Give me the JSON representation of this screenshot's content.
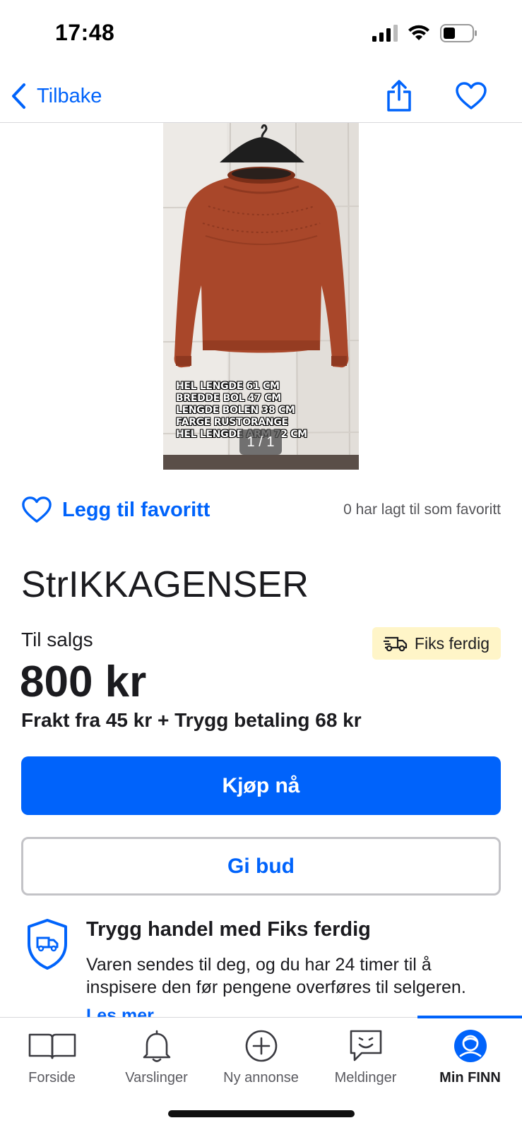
{
  "status_bar": {
    "time": "17:48"
  },
  "nav": {
    "back_label": "Tilbake",
    "icons": [
      "chevron-left-icon",
      "share-icon",
      "heart-outline-icon"
    ]
  },
  "gallery": {
    "counter": "1 / 1",
    "image_description_colors": {
      "sweater": "#a9472a",
      "wall": "#e9e6e2"
    },
    "overlay_lines": [
      "HEL LENGDE 61 CM",
      "BREDDE BOL 47 CM",
      "LENGDE BOLEN 38 CM",
      "FARGE RUSTORANGE",
      "HEL LENGDE ARM 72 CM"
    ]
  },
  "favorite": {
    "add_label": "Legg til favoritt",
    "count_text": "0 har lagt til som favoritt"
  },
  "listing": {
    "title": "StrIKKAGENSER",
    "sale_label": "Til salgs",
    "badge_label": "Fiks ferdig",
    "price": "800 kr",
    "shipping": "Frakt fra 45 kr + Trygg betaling 68 kr"
  },
  "actions": {
    "buy_label": "Kjøp nå",
    "bid_label": "Gi bud"
  },
  "safe_trade": {
    "title": "Trygg handel med Fiks ferdig",
    "text": "Varen sendes til deg, og du har 24 timer til å inspisere den før pengene overføres til selgeren.",
    "read_more": "Les mer"
  },
  "tab_bar": {
    "tabs": [
      {
        "label": "Forside",
        "icon": "book-icon"
      },
      {
        "label": "Varslinger",
        "icon": "bell-icon"
      },
      {
        "label": "Ny annonse",
        "icon": "plus-circle-icon"
      },
      {
        "label": "Meldinger",
        "icon": "message-icon"
      },
      {
        "label": "Min FINN",
        "icon": "profile-icon",
        "active": true
      }
    ]
  },
  "colors": {
    "accent": "#0063fb",
    "badge_bg": "#fff5c8",
    "text": "#1b1b1f",
    "muted": "#555559"
  }
}
